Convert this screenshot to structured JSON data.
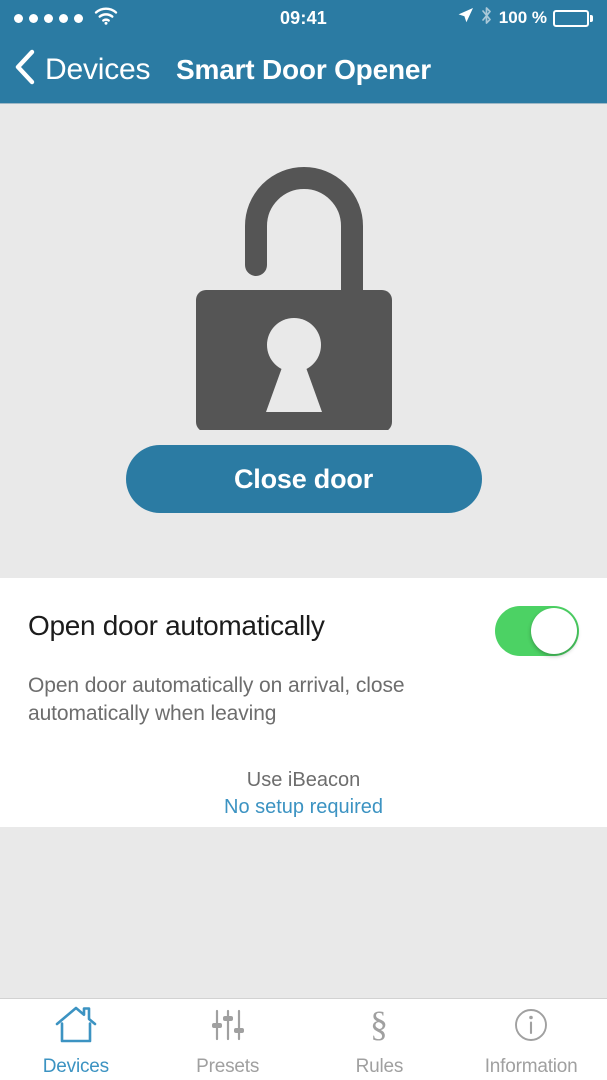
{
  "status_bar": {
    "signal_dots": 5,
    "wifi_icon": "wifi-icon",
    "time": "09:41",
    "location_icon": "location-arrow-icon",
    "bluetooth_icon": "bluetooth-icon",
    "battery_percent": "100 %",
    "battery_level": 100
  },
  "nav": {
    "back_label": "Devices",
    "back_icon": "chevron-left-icon",
    "title": "Smart Door Opener"
  },
  "hero": {
    "lock_icon": "open-padlock-icon",
    "lock_state": "unlocked",
    "primary_button_label": "Close door"
  },
  "settings": {
    "title": "Open door automatically",
    "toggle_state": "on",
    "description": "Open door automatically on arrival, close automatically when leaving",
    "beacon_label": "Use iBeacon",
    "beacon_link": "No setup required"
  },
  "tabs": [
    {
      "label": "Devices",
      "icon": "house-icon",
      "active": true
    },
    {
      "label": "Presets",
      "icon": "sliders-icon",
      "active": false
    },
    {
      "label": "Rules",
      "icon": "section-sign-icon",
      "active": false
    },
    {
      "label": "Information",
      "icon": "info-circle-icon",
      "active": false
    }
  ],
  "colors": {
    "brand_blue": "#2b7ba3",
    "link_blue": "#3c93c2",
    "toggle_green": "#4cd264",
    "lock_gray": "#555555",
    "page_gray": "#e9e9e9"
  }
}
